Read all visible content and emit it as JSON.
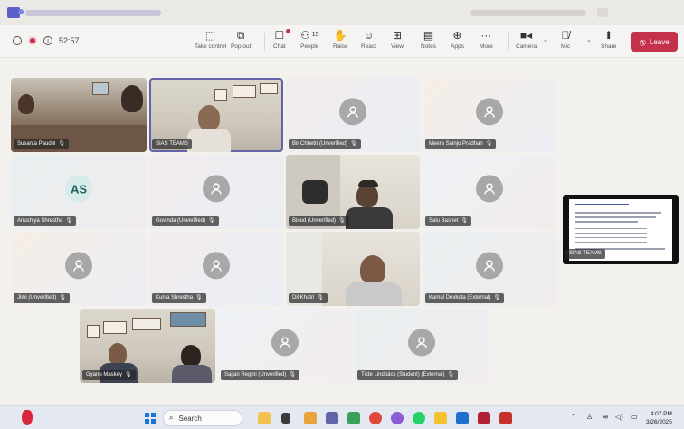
{
  "meeting": {
    "timer": "52:57",
    "toolbar": [
      {
        "key": "take_control",
        "label": "Take control",
        "icon": "take-control-icon"
      },
      {
        "key": "pop_out",
        "label": "Pop out",
        "icon": "pop-out-icon"
      },
      {
        "key": "chat",
        "label": "Chat",
        "icon": "chat-icon"
      },
      {
        "key": "people",
        "label": "People",
        "count": "15",
        "icon": "people-icon"
      },
      {
        "key": "raise",
        "label": "Raise",
        "icon": "raise-hand-icon"
      },
      {
        "key": "react",
        "label": "React",
        "icon": "react-icon"
      },
      {
        "key": "view",
        "label": "View",
        "icon": "view-icon"
      },
      {
        "key": "notes",
        "label": "Notes",
        "icon": "notes-icon"
      },
      {
        "key": "apps",
        "label": "Apps",
        "icon": "apps-icon"
      },
      {
        "key": "more",
        "label": "More",
        "icon": "more-icon"
      },
      {
        "key": "camera",
        "label": "Camera",
        "icon": "camera-icon"
      },
      {
        "key": "mic",
        "label": "Mic",
        "icon": "mic-off-icon"
      },
      {
        "key": "share",
        "label": "Share",
        "icon": "share-icon"
      }
    ],
    "leave_label": "Leave"
  },
  "participants": [
    {
      "name": "Susanta Paudel",
      "video": true
    },
    {
      "name": "SIAS TEAMS",
      "video": true,
      "selected": true
    },
    {
      "name": "Bir Chhetri (Unverified)",
      "video": false
    },
    {
      "name": "Meera Sainju Pradhan",
      "video": false
    },
    {
      "name": "Anushiya Shrestha",
      "video": false,
      "initials": "AS"
    },
    {
      "name": "Govinda (Unverified)",
      "video": false
    },
    {
      "name": "Binod (Unverified)",
      "video": true
    },
    {
      "name": "Salu Basnet",
      "video": false
    },
    {
      "name": "Jimi (Unverified)",
      "video": false
    },
    {
      "name": "Kunja Shrestha",
      "video": false
    },
    {
      "name": "Dil Khatri",
      "video": true
    },
    {
      "name": "Kamal Devkota (External)",
      "video": false
    },
    {
      "name": "Gyanu Maskey",
      "video": true
    },
    {
      "name": "Sajjan Regmi (Unverified)",
      "video": false
    },
    {
      "name": "Tilde Lindbäck (Student) (External)",
      "video": false
    }
  ],
  "shared_screen": {
    "presenter": "SIAS TEAMS"
  },
  "taskbar": {
    "search_placeholder": "Search",
    "time": "4:07 PM",
    "date": "3/26/2025"
  },
  "colors": {
    "accent": "#6264a7",
    "leave": "#c4314b",
    "record": "#c4314b"
  }
}
